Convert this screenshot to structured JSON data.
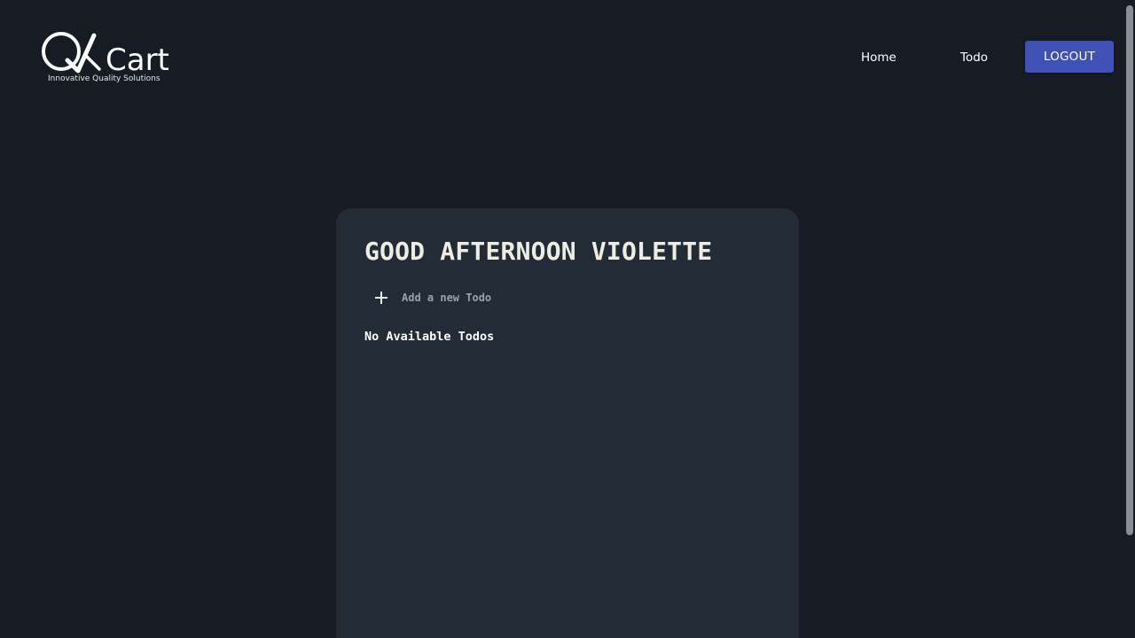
{
  "brand": {
    "logo_text": "QACart",
    "tagline": "Innovative Quality Solutions"
  },
  "nav": {
    "home_label": "Home",
    "todo_label": "Todo",
    "logout_label": "LOGOUT"
  },
  "main": {
    "greeting": "GOOD AFTERNOON VIOLETTE",
    "add_todo_placeholder": "Add a new Todo",
    "empty_message": "No Available Todos"
  },
  "colors": {
    "background": "#171c24",
    "card": "#222b36",
    "logout_button": "#4051b5",
    "heading_text": "#efece3"
  },
  "icons": {
    "add": "plus-icon"
  }
}
